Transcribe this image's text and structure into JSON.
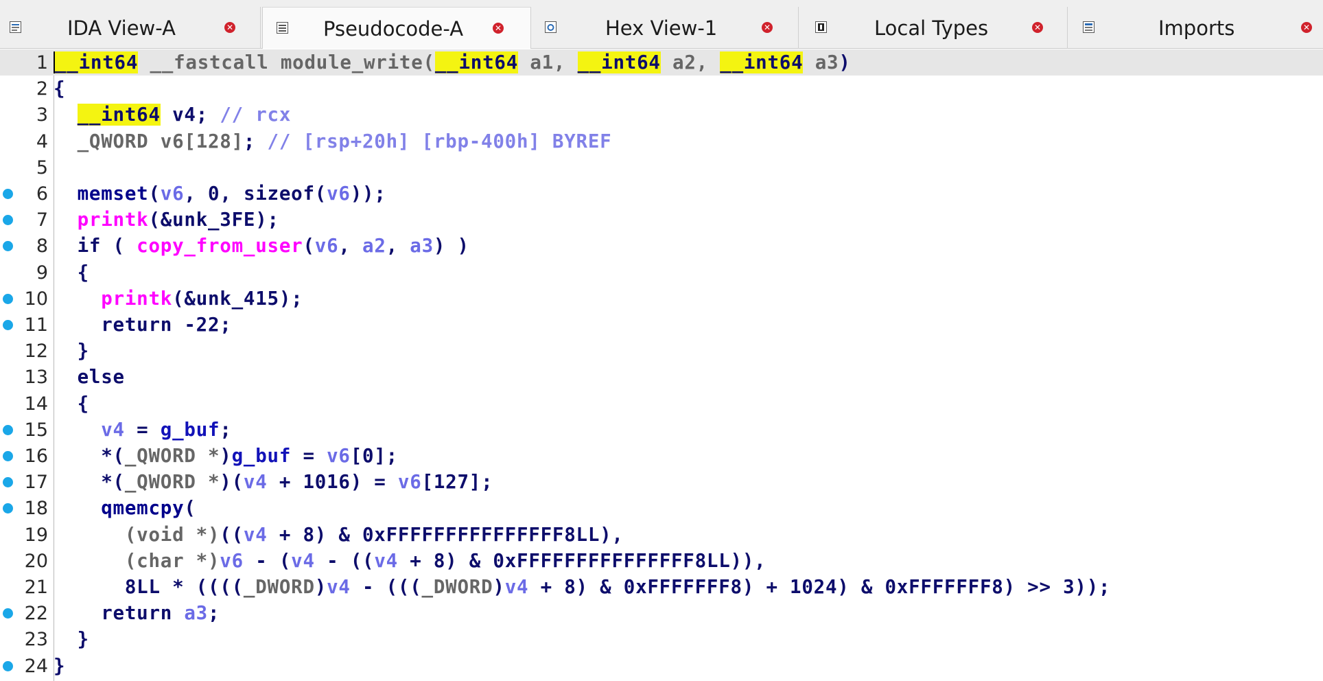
{
  "tabs": [
    {
      "label": "IDA View-A",
      "icon": "ida-view-icon",
      "active": false
    },
    {
      "label": "Pseudocode-A",
      "icon": "pseudocode-icon",
      "active": true
    },
    {
      "label": "Hex View-1",
      "icon": "hex-view-icon",
      "active": false
    },
    {
      "label": "Local Types",
      "icon": "local-types-icon",
      "active": false
    },
    {
      "label": "Imports",
      "icon": "imports-icon",
      "active": false
    }
  ],
  "colors": {
    "highlight": "#f4f411",
    "breakpoint_dot": "#1aa7e8",
    "imported_function": "#ff00ff",
    "variable": "#6b6be6",
    "comment": "#8181e8",
    "keyword": "#0d0d6b"
  },
  "code_lines": [
    {
      "n": "1",
      "dot": false,
      "tokens": [
        {
          "t": "__int64",
          "c": "k-typ",
          "hl": true
        },
        {
          "t": " "
        },
        {
          "t": "__fastcall",
          "c": "k-gray"
        },
        {
          "t": " "
        },
        {
          "t": "module_write",
          "c": "k-gray"
        },
        {
          "t": "(",
          "c": "k-gray"
        },
        {
          "t": "__int64",
          "c": "k-typ",
          "hl": true
        },
        {
          "t": " a1, ",
          "c": "k-gray"
        },
        {
          "t": "__int64",
          "c": "k-typ",
          "hl": true
        },
        {
          "t": " a2, ",
          "c": "k-gray"
        },
        {
          "t": "__int64",
          "c": "k-typ",
          "hl": true
        },
        {
          "t": " a3",
          "c": "k-gray"
        },
        {
          "t": ")"
        }
      ]
    },
    {
      "n": "2",
      "dot": false,
      "tokens": [
        {
          "t": "{"
        }
      ]
    },
    {
      "n": "3",
      "dot": false,
      "tokens": [
        {
          "t": "  "
        },
        {
          "t": "__int64",
          "c": "k-typ",
          "hl": true
        },
        {
          "t": " v4; "
        },
        {
          "t": "// rcx",
          "c": "k-com"
        }
      ]
    },
    {
      "n": "4",
      "dot": false,
      "tokens": [
        {
          "t": "  "
        },
        {
          "t": "_QWORD",
          "c": "k-gray"
        },
        {
          "t": " v6[128]",
          "c": "k-gray"
        },
        {
          "t": "; "
        },
        {
          "t": "// [rsp+20h] [rbp-400h] BYREF",
          "c": "k-com"
        }
      ]
    },
    {
      "n": "5",
      "dot": false,
      "tokens": []
    },
    {
      "n": "6",
      "dot": true,
      "tokens": [
        {
          "t": "  "
        },
        {
          "t": "memset",
          "c": "k-fn"
        },
        {
          "t": "("
        },
        {
          "t": "v6",
          "c": "k-var"
        },
        {
          "t": ", 0, sizeof("
        },
        {
          "t": "v6",
          "c": "k-var"
        },
        {
          "t": "));"
        }
      ]
    },
    {
      "n": "7",
      "dot": true,
      "tokens": [
        {
          "t": "  "
        },
        {
          "t": "printk",
          "c": "k-imp"
        },
        {
          "t": "(&unk_3FE);"
        }
      ]
    },
    {
      "n": "8",
      "dot": true,
      "tokens": [
        {
          "t": "  if ( "
        },
        {
          "t": "copy_from_user",
          "c": "k-imp"
        },
        {
          "t": "("
        },
        {
          "t": "v6",
          "c": "k-var"
        },
        {
          "t": ", "
        },
        {
          "t": "a2",
          "c": "k-var"
        },
        {
          "t": ", "
        },
        {
          "t": "a3",
          "c": "k-var"
        },
        {
          "t": ") )"
        }
      ]
    },
    {
      "n": "9",
      "dot": false,
      "tokens": [
        {
          "t": "  {"
        }
      ]
    },
    {
      "n": "10",
      "dot": true,
      "tokens": [
        {
          "t": "    "
        },
        {
          "t": "printk",
          "c": "k-imp"
        },
        {
          "t": "(&unk_415);"
        }
      ]
    },
    {
      "n": "11",
      "dot": true,
      "tokens": [
        {
          "t": "    return -22;"
        }
      ]
    },
    {
      "n": "12",
      "dot": false,
      "tokens": [
        {
          "t": "  }"
        }
      ]
    },
    {
      "n": "13",
      "dot": false,
      "tokens": [
        {
          "t": "  else"
        }
      ]
    },
    {
      "n": "14",
      "dot": false,
      "tokens": [
        {
          "t": "  {"
        }
      ]
    },
    {
      "n": "15",
      "dot": true,
      "tokens": [
        {
          "t": "    "
        },
        {
          "t": "v4",
          "c": "k-var"
        },
        {
          "t": " = "
        },
        {
          "t": "g_buf",
          "c": "k-glob"
        },
        {
          "t": ";"
        }
      ]
    },
    {
      "n": "16",
      "dot": true,
      "tokens": [
        {
          "t": "    *("
        },
        {
          "t": "_QWORD *",
          "c": "k-gray"
        },
        {
          "t": ")"
        },
        {
          "t": "g_buf",
          "c": "k-glob"
        },
        {
          "t": " = "
        },
        {
          "t": "v6",
          "c": "k-var"
        },
        {
          "t": "[0];"
        }
      ]
    },
    {
      "n": "17",
      "dot": true,
      "tokens": [
        {
          "t": "    *("
        },
        {
          "t": "_QWORD *",
          "c": "k-gray"
        },
        {
          "t": ")("
        },
        {
          "t": "v4",
          "c": "k-var"
        },
        {
          "t": " + 1016) = "
        },
        {
          "t": "v6",
          "c": "k-var"
        },
        {
          "t": "[127];"
        }
      ]
    },
    {
      "n": "18",
      "dot": true,
      "tokens": [
        {
          "t": "    "
        },
        {
          "t": "qmemcpy",
          "c": "k-fn"
        },
        {
          "t": "("
        }
      ]
    },
    {
      "n": "19",
      "dot": false,
      "tokens": [
        {
          "t": "      "
        },
        {
          "t": "(void *)",
          "c": "k-gray"
        },
        {
          "t": "(("
        },
        {
          "t": "v4",
          "c": "k-var"
        },
        {
          "t": " + 8) & 0xFFFFFFFFFFFFFFF8LL),"
        }
      ]
    },
    {
      "n": "20",
      "dot": false,
      "tokens": [
        {
          "t": "      "
        },
        {
          "t": "(char *)",
          "c": "k-gray"
        },
        {
          "t": "v6",
          "c": "k-var"
        },
        {
          "t": " - ("
        },
        {
          "t": "v4",
          "c": "k-var"
        },
        {
          "t": " - (("
        },
        {
          "t": "v4",
          "c": "k-var"
        },
        {
          "t": " + 8) & 0xFFFFFFFFFFFFFFF8LL)),"
        }
      ]
    },
    {
      "n": "21",
      "dot": false,
      "tokens": [
        {
          "t": "      8LL * (((("
        },
        {
          "t": "_DWORD",
          "c": "k-gray"
        },
        {
          "t": ")"
        },
        {
          "t": "v4",
          "c": "k-var"
        },
        {
          "t": " - ((("
        },
        {
          "t": "_DWORD",
          "c": "k-gray"
        },
        {
          "t": ")"
        },
        {
          "t": "v4",
          "c": "k-var"
        },
        {
          "t": " + 8) & 0xFFFFFFF8) + 1024) & 0xFFFFFFF8) >> 3));"
        }
      ]
    },
    {
      "n": "22",
      "dot": true,
      "tokens": [
        {
          "t": "    return "
        },
        {
          "t": "a3",
          "c": "k-var"
        },
        {
          "t": ";"
        }
      ]
    },
    {
      "n": "23",
      "dot": false,
      "tokens": [
        {
          "t": "  }"
        }
      ]
    },
    {
      "n": "24",
      "dot": true,
      "tokens": [
        {
          "t": "}"
        }
      ]
    }
  ]
}
